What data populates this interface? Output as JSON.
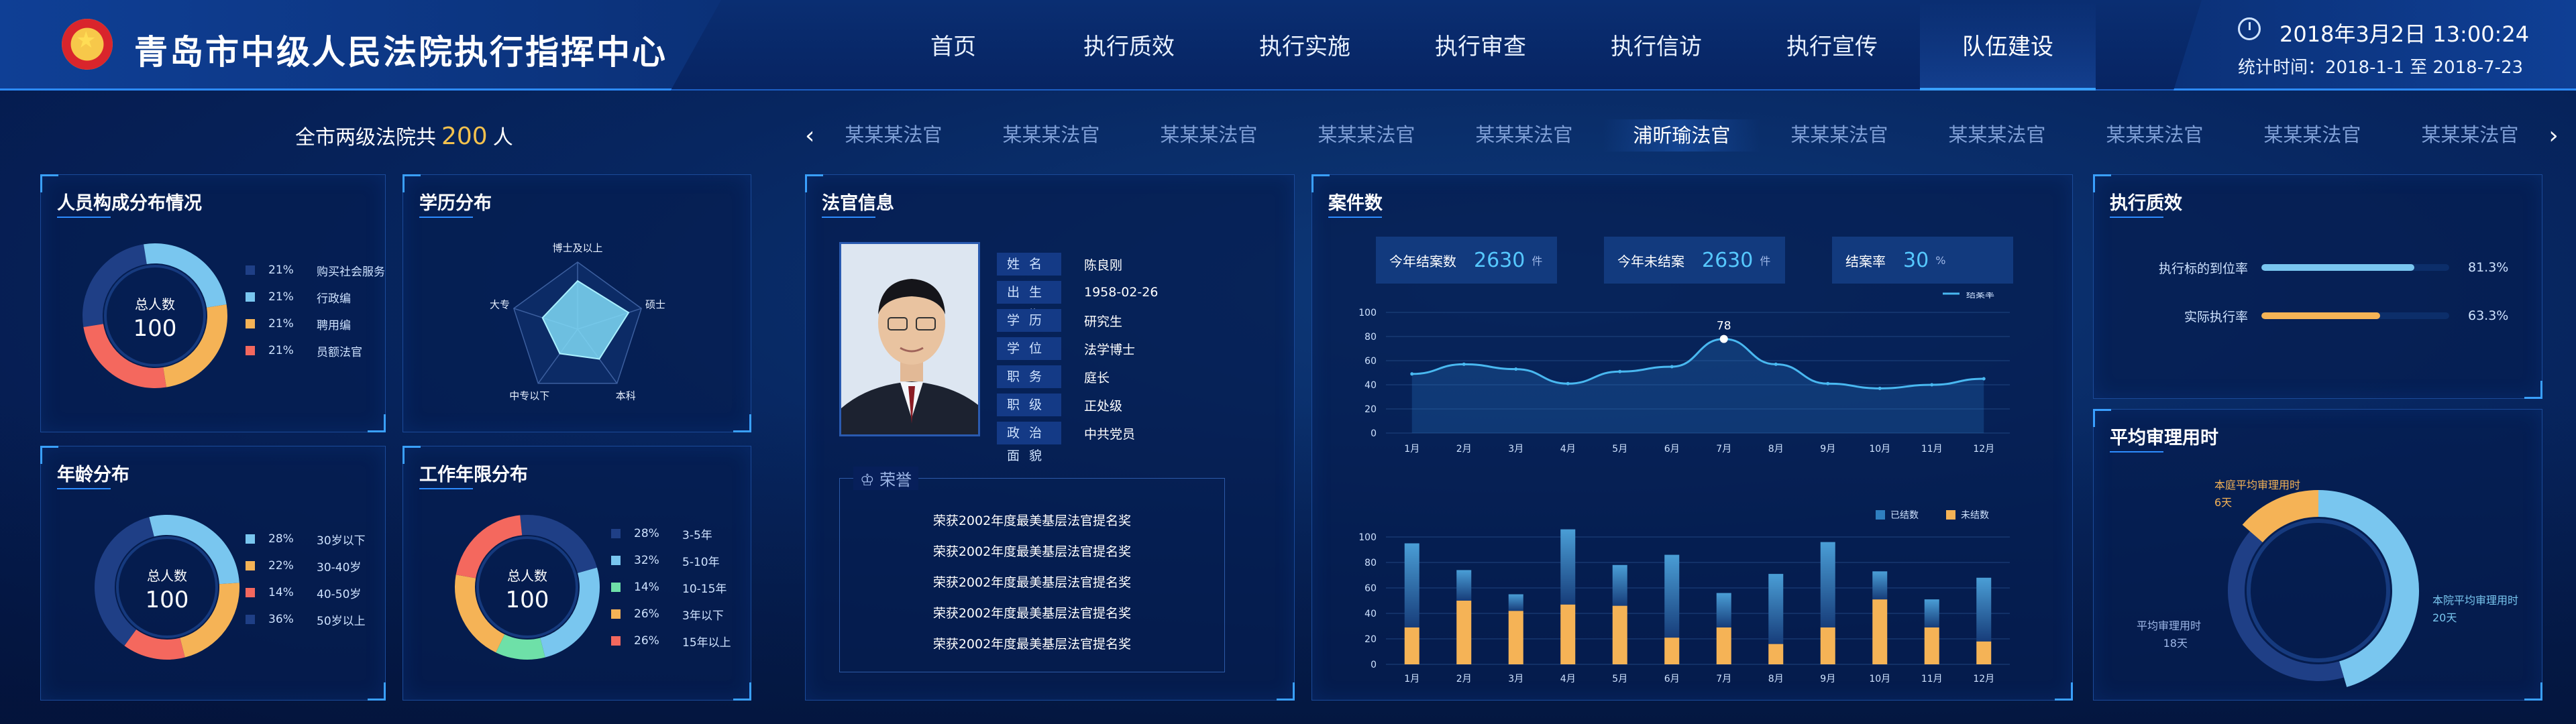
{
  "header": {
    "title": "青岛市中级人民法院执行指挥中心",
    "nav": [
      "首页",
      "执行质效",
      "执行实施",
      "执行审查",
      "执行信访",
      "执行宣传",
      "队伍建设"
    ],
    "active_nav": "队伍建设",
    "datetime": "2018年3月2日   13:00:24",
    "stat_period": "统计时间：2018-1-1 至 2018-7-23"
  },
  "total": {
    "prefix": "全市两级法院共",
    "count": "200",
    "suffix": "人"
  },
  "judges": {
    "items": [
      "某某某法官",
      "某某某法官",
      "某某某法官",
      "某某某法官",
      "某某某法官",
      "浦昕瑜法官",
      "某某某法官",
      "某某某法官",
      "某某某法官",
      "某某某法官",
      "某某某法官"
    ],
    "active": "浦昕瑜法官"
  },
  "composition": {
    "title": "人员构成分布情况",
    "center_label": "总人数",
    "center_value": "100",
    "items": [
      {
        "pct": "21%",
        "label": "购买社会服务",
        "value": 21,
        "color": "#1f3f86"
      },
      {
        "pct": "21%",
        "label": "行政编",
        "value": 21,
        "color": "#79c6ef"
      },
      {
        "pct": "21%",
        "label": "聘用编",
        "value": 21,
        "color": "#f5b356"
      },
      {
        "pct": "21%",
        "label": "员额法官",
        "value": 21,
        "color": "#f4685e"
      }
    ]
  },
  "education": {
    "title": "学历分布",
    "axes": [
      "博士及以上",
      "硕士",
      "本科",
      "中专以下",
      "大专"
    ],
    "values": [
      0.72,
      0.8,
      0.55,
      0.45,
      0.55
    ],
    "color": "#7fd9f6"
  },
  "age": {
    "title": "年龄分布",
    "center_label": "总人数",
    "center_value": "100",
    "items": [
      {
        "pct": "28%",
        "label": "30岁以下",
        "value": 28,
        "color": "#79c6ef"
      },
      {
        "pct": "22%",
        "label": "30-40岁",
        "value": 22,
        "color": "#f5b356"
      },
      {
        "pct": "14%",
        "label": "40-50岁",
        "value": 14,
        "color": "#f4685e"
      },
      {
        "pct": "36%",
        "label": "50岁以上",
        "value": 36,
        "color": "#1f3f86"
      }
    ]
  },
  "tenure": {
    "title": "工作年限分布",
    "center_label": "总人数",
    "center_value": "100",
    "items": [
      {
        "pct": "28%",
        "label": "3-5年",
        "value": 28,
        "color": "#1f3f86"
      },
      {
        "pct": "32%",
        "label": "5-10年",
        "value": 32,
        "color": "#79c6ef"
      },
      {
        "pct": "14%",
        "label": "10-15年",
        "value": 14,
        "color": "#6ee0a8"
      },
      {
        "pct": "26%",
        "label": "3年以下",
        "value": 26,
        "color": "#f5b356"
      },
      {
        "pct": "26%",
        "label": "15年以上",
        "value": 26,
        "color": "#f4685e"
      }
    ]
  },
  "judge_info": {
    "title": "法官信息",
    "fields": [
      {
        "k": "姓名",
        "v": "陈良刚"
      },
      {
        "k": "出生日期",
        "v": "1958-02-26"
      },
      {
        "k": "学历",
        "v": "研究生"
      },
      {
        "k": "学位",
        "v": "法学博士"
      },
      {
        "k": "职务",
        "v": "庭长"
      },
      {
        "k": "职级",
        "v": "正处级"
      },
      {
        "k": "政治面貌",
        "v": "中共党员"
      }
    ],
    "honor_label": "荣誉",
    "honors": [
      "荣获2002年度最美基层法官提名奖",
      "荣获2002年度最美基层法官提名奖",
      "荣获2002年度最美基层法官提名奖",
      "荣获2002年度最美基层法官提名奖",
      "荣获2002年度最美基层法官提名奖"
    ]
  },
  "cases": {
    "title": "案件数",
    "kpis": [
      {
        "label": "今年结案数",
        "value": "2630",
        "unit": "件"
      },
      {
        "label": "今年未结案",
        "value": "2630",
        "unit": "件"
      },
      {
        "label": "结案率",
        "value": "30",
        "unit": "%"
      }
    ]
  },
  "chart_data": [
    {
      "type": "line",
      "legend": [
        "结案率"
      ],
      "x": [
        "1月",
        "2月",
        "3月",
        "4月",
        "5月",
        "6月",
        "7月",
        "8月",
        "9月",
        "10月",
        "11月",
        "12月"
      ],
      "series": [
        {
          "name": "结案率",
          "values": [
            49,
            57,
            53,
            41,
            51,
            55,
            78,
            57,
            41,
            37,
            40,
            45
          ]
        }
      ],
      "peak_label": "78",
      "ylim": [
        0,
        100
      ],
      "yticks": [
        0,
        20,
        40,
        60,
        80,
        100
      ],
      "color": "#49b8f0"
    },
    {
      "type": "bar",
      "stacked": true,
      "legend": [
        "已结数",
        "未结数"
      ],
      "categories": [
        "1月",
        "2月",
        "3月",
        "4月",
        "5月",
        "6月",
        "7月",
        "8月",
        "9月",
        "10月",
        "11月",
        "12月"
      ],
      "series": [
        {
          "name": "已结数",
          "values": [
            66,
            24,
            13,
            59,
            32,
            65,
            27,
            55,
            67,
            22,
            22,
            50
          ],
          "color": "#2f7fbf"
        },
        {
          "name": "未结数",
          "values": [
            29,
            50,
            42,
            47,
            46,
            21,
            29,
            16,
            29,
            51,
            29,
            18
          ],
          "color": "#f5b356"
        }
      ],
      "ylim": [
        0,
        100
      ],
      "yticks": [
        0,
        20,
        40,
        60,
        80,
        100
      ]
    }
  ],
  "quality": {
    "title": "执行质效",
    "rows": [
      {
        "label": "执行标的到位率",
        "value": "81.3%",
        "ratio": 0.813,
        "color": "#79c6ef"
      },
      {
        "label": "实际执行率",
        "value": "63.3%",
        "ratio": 0.633,
        "color": "#f5b356"
      }
    ]
  },
  "trial_time": {
    "title": "平均审理用时",
    "segments": [
      {
        "label": "本院平均审理用时",
        "days": "20天",
        "value": 20,
        "color": "#79c6ef"
      },
      {
        "label": "平均审理用时",
        "days": "18天",
        "value": 18,
        "color": "#1f3f86"
      },
      {
        "label": "本庭平均审理用时",
        "days": "6天",
        "value": 6,
        "color": "#f5b356"
      }
    ]
  }
}
